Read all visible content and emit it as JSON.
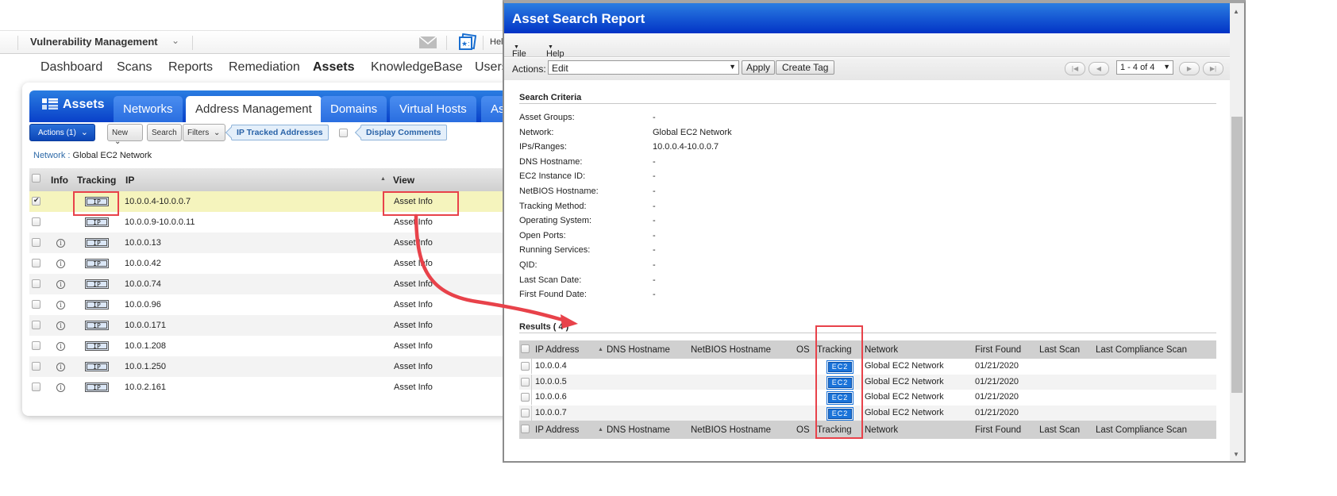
{
  "topbar": {
    "module": "Vulnerability Management",
    "help_partial": "Hel"
  },
  "mainnav": {
    "items": [
      "Dashboard",
      "Scans",
      "Reports",
      "Remediation",
      "Assets",
      "KnowledgeBase",
      "Users"
    ],
    "active": "Assets"
  },
  "assets_panel": {
    "title": "Assets",
    "tabs": [
      "Networks",
      "Address Management",
      "Domains",
      "Virtual Hosts",
      "As"
    ],
    "active_tab": "Address Management",
    "toolbar": {
      "actions_label": "Actions (1)",
      "new_label": "New",
      "search_label": "Search",
      "filters_label": "Filters",
      "ip_tracked_tag": "IP Tracked Addresses",
      "display_comments_tag": "Display Comments"
    },
    "network_label": "Network :",
    "network_value": "Global EC2 Network",
    "columns": [
      "Info",
      "Tracking",
      "IP",
      "View"
    ],
    "rows": [
      {
        "info": false,
        "tracking": "IP",
        "ip": "10.0.0.4-10.0.0.7",
        "view": "Asset Info",
        "checked": true
      },
      {
        "info": false,
        "tracking": "IP",
        "ip": "10.0.0.9-10.0.0.11",
        "view": "Asset Info",
        "checked": false
      },
      {
        "info": true,
        "tracking": "IP",
        "ip": "10.0.0.13",
        "view": "Asset Info",
        "checked": false
      },
      {
        "info": true,
        "tracking": "IP",
        "ip": "10.0.0.42",
        "view": "Asset Info",
        "checked": false
      },
      {
        "info": true,
        "tracking": "IP",
        "ip": "10.0.0.74",
        "view": "Asset Info",
        "checked": false
      },
      {
        "info": true,
        "tracking": "IP",
        "ip": "10.0.0.96",
        "view": "Asset Info",
        "checked": false
      },
      {
        "info": true,
        "tracking": "IP",
        "ip": "10.0.0.171",
        "view": "Asset Info",
        "checked": false
      },
      {
        "info": true,
        "tracking": "IP",
        "ip": "10.0.1.208",
        "view": "Asset Info",
        "checked": false
      },
      {
        "info": true,
        "tracking": "IP",
        "ip": "10.0.1.250",
        "view": "Asset Info",
        "checked": false
      },
      {
        "info": true,
        "tracking": "IP",
        "ip": "10.0.2.161",
        "view": "Asset Info",
        "checked": false
      }
    ]
  },
  "report": {
    "title": "Asset Search Report",
    "menu": [
      "File",
      "Help"
    ],
    "actions_label": "Actions:",
    "actions_value": "Edit",
    "apply_label": "Apply",
    "create_tag_label": "Create Tag",
    "pager_value": "1 - 4 of 4",
    "search_criteria_title": "Search Criteria",
    "criteria": [
      {
        "key": "Asset Groups:",
        "value": "-"
      },
      {
        "key": "Network:",
        "value": "Global EC2 Network"
      },
      {
        "key": "IPs/Ranges:",
        "value": "10.0.0.4-10.0.0.7"
      },
      {
        "key": "DNS Hostname:",
        "value": "-"
      },
      {
        "key": "EC2 Instance ID:",
        "value": "-"
      },
      {
        "key": "NetBIOS Hostname:",
        "value": "-"
      },
      {
        "key": "Tracking Method:",
        "value": "-"
      },
      {
        "key": "Operating System:",
        "value": "-"
      },
      {
        "key": "Open Ports:",
        "value": "-"
      },
      {
        "key": "Running Services:",
        "value": "-"
      },
      {
        "key": "QID:",
        "value": "-"
      },
      {
        "key": "Last Scan Date:",
        "value": "-"
      },
      {
        "key": "First Found Date:",
        "value": "-"
      }
    ],
    "results_title": "Results ( 4 )",
    "result_columns": [
      "IP Address",
      "DNS Hostname",
      "NetBIOS Hostname",
      "OS",
      "Tracking",
      "Network",
      "First Found",
      "Last Scan",
      "Last Compliance Scan"
    ],
    "results": [
      {
        "ip": "10.0.0.4",
        "dns": "",
        "netbios": "",
        "os": "",
        "tracking": "EC2",
        "network": "Global EC2 Network",
        "first_found": "01/21/2020",
        "last_scan": "",
        "last_compliance": ""
      },
      {
        "ip": "10.0.0.5",
        "dns": "",
        "netbios": "",
        "os": "",
        "tracking": "EC2",
        "network": "Global EC2 Network",
        "first_found": "01/21/2020",
        "last_scan": "",
        "last_compliance": ""
      },
      {
        "ip": "10.0.0.6",
        "dns": "",
        "netbios": "",
        "os": "",
        "tracking": "EC2",
        "network": "Global EC2 Network",
        "first_found": "01/21/2020",
        "last_scan": "",
        "last_compliance": ""
      },
      {
        "ip": "10.0.0.7",
        "dns": "",
        "netbios": "",
        "os": "",
        "tracking": "EC2",
        "network": "Global EC2 Network",
        "first_found": "01/21/2020",
        "last_scan": "",
        "last_compliance": ""
      }
    ]
  },
  "colors": {
    "brand_blue": "#0940c9",
    "highlight_row": "#f5f4bd",
    "annotation_red": "#e8424a",
    "ec2_badge": "#1a73d9"
  }
}
